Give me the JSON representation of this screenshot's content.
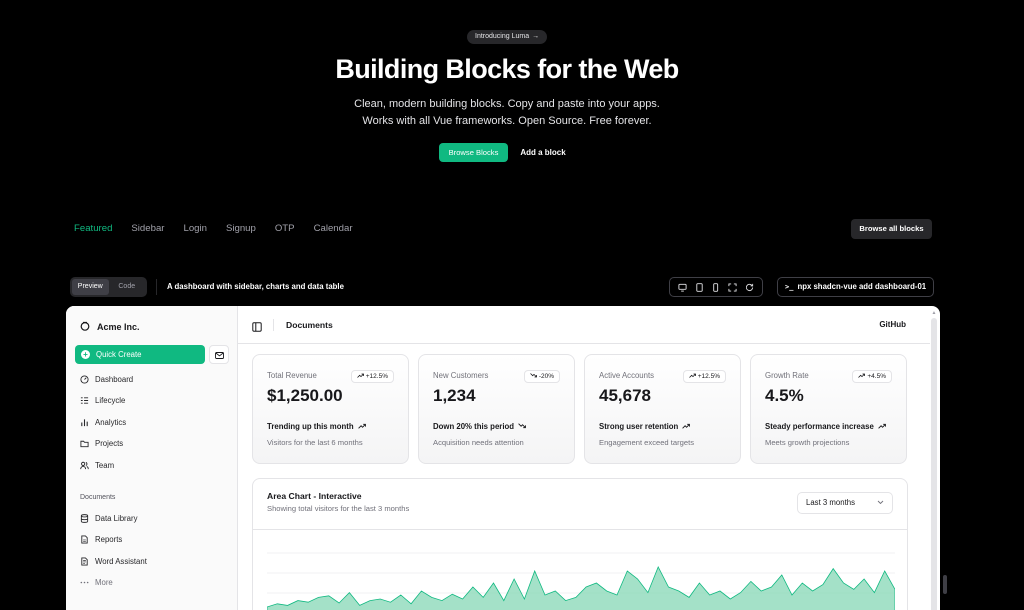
{
  "hero": {
    "pill": "Introducing Luma",
    "pill_arrow": "→",
    "title": "Building Blocks for the Web",
    "subtitle_line1": "Clean, modern building blocks. Copy and paste into your apps.",
    "subtitle_line2": "Works with all Vue frameworks. Open Source. Free forever.",
    "primary_button": "Browse Blocks",
    "secondary_button": "Add a block"
  },
  "tabs": [
    {
      "label": "Featured",
      "active": true
    },
    {
      "label": "Sidebar"
    },
    {
      "label": "Login"
    },
    {
      "label": "Signup"
    },
    {
      "label": "OTP"
    },
    {
      "label": "Calendar"
    }
  ],
  "browse_all": "Browse all blocks",
  "preview_bar": {
    "segments": [
      "Preview",
      "Code"
    ],
    "active_segment": "Preview",
    "description": "A dashboard with sidebar, charts and data table",
    "device_icons": [
      "monitor-icon",
      "tablet-icon",
      "phone-icon",
      "fullscreen-icon",
      "refresh-icon"
    ],
    "command_prefix": ">_",
    "command": "npx shadcn-vue add dashboard-01"
  },
  "dashboard": {
    "brand": "Acme Inc.",
    "quick_create": "Quick Create",
    "nav": [
      {
        "label": "Dashboard",
        "icon": "gauge-icon"
      },
      {
        "label": "Lifecycle",
        "icon": "list-icon"
      },
      {
        "label": "Analytics",
        "icon": "bar-chart-icon"
      },
      {
        "label": "Projects",
        "icon": "folder-icon"
      },
      {
        "label": "Team",
        "icon": "users-icon"
      }
    ],
    "documents_heading": "Documents",
    "documents": [
      {
        "label": "Data Library",
        "icon": "database-icon"
      },
      {
        "label": "Reports",
        "icon": "file-icon"
      },
      {
        "label": "Word Assistant",
        "icon": "file-text-icon"
      },
      {
        "label": "More",
        "icon": "more-icon"
      }
    ],
    "topbar_title": "Documents",
    "topbar_link": "GitHub",
    "cards": [
      {
        "label": "Total Revenue",
        "badge": "+12.5%",
        "trend": "up",
        "value": "$1,250.00",
        "foot1": "Trending up this month",
        "foot2": "Visitors for the last 6 months"
      },
      {
        "label": "New Customers",
        "badge": "-20%",
        "trend": "down",
        "value": "1,234",
        "foot1": "Down 20% this period",
        "foot2": "Acquisition needs attention"
      },
      {
        "label": "Active Accounts",
        "badge": "+12.5%",
        "trend": "up",
        "value": "45,678",
        "foot1": "Strong user retention",
        "foot2": "Engagement exceed targets"
      },
      {
        "label": "Growth Rate",
        "badge": "+4.5%",
        "trend": "up",
        "value": "4.5%",
        "foot1": "Steady performance increase",
        "foot2": "Meets growth projections"
      }
    ],
    "chart": {
      "title": "Area Chart - Interactive",
      "subtitle": "Showing total visitors for the last 3 months",
      "range_select": "Last 3 months",
      "accent": "#10b981",
      "fill": "#86d7b6"
    }
  },
  "chart_data": {
    "type": "area",
    "title": "Area Chart - Interactive",
    "subtitle": "Showing total visitors for the last 3 months",
    "series": [
      {
        "values": [
          10,
          14,
          12,
          18,
          16,
          22,
          24,
          15,
          28,
          12,
          18,
          20,
          16,
          25,
          14,
          30,
          22,
          18,
          26,
          20,
          35,
          22,
          40,
          18,
          45,
          20,
          55,
          25,
          30,
          18,
          22,
          35,
          40,
          30,
          25,
          55,
          45,
          28,
          60,
          35,
          30,
          22,
          40,
          25,
          30,
          20,
          28,
          42,
          30,
          35,
          50,
          25,
          40,
          30,
          38,
          58,
          40,
          32,
          45,
          28,
          55,
          32
        ]
      }
    ]
  }
}
